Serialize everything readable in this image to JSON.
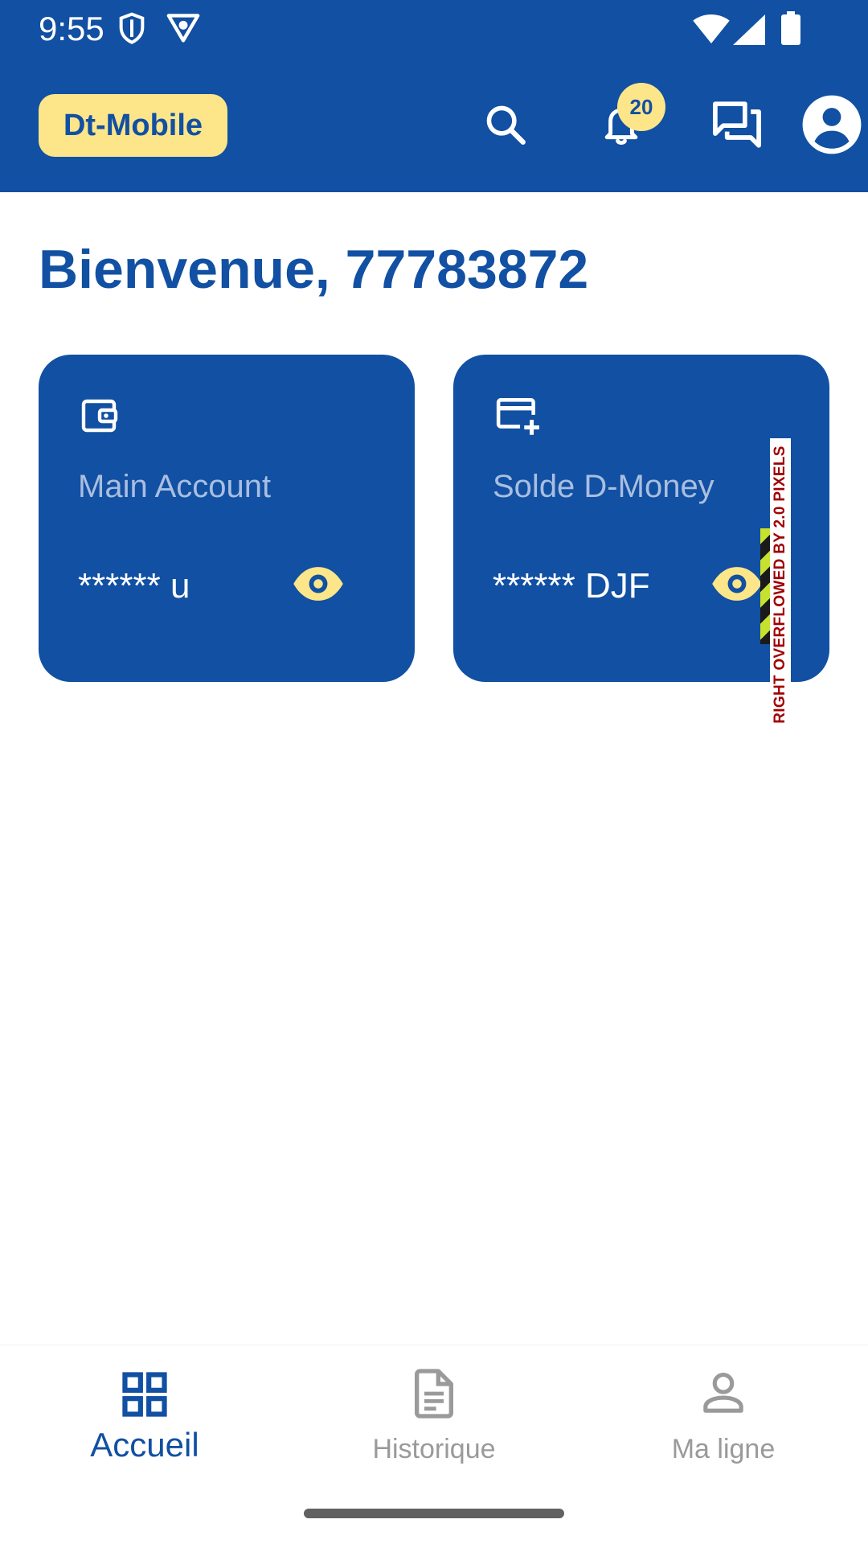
{
  "status_bar": {
    "time": "9:55",
    "left_icons": [
      "shield-icon",
      "vpn-icon"
    ],
    "right_icons": [
      "wifi-icon",
      "signal-icon",
      "battery-icon"
    ]
  },
  "app_bar": {
    "brand": "Dt-Mobile",
    "actions": [
      "search-icon",
      "notifications-icon",
      "chat-icon",
      "account-icon"
    ],
    "notification_count": "20"
  },
  "welcome": {
    "text": "Bienvenue, 77783872"
  },
  "cards": [
    {
      "icon": "wallet-icon",
      "label": "Main Account",
      "value": "****** u",
      "toggle_icon": "eye-icon"
    },
    {
      "icon": "card-add-icon",
      "label": "Solde D-Money",
      "value": "****** DJF",
      "toggle_icon": "eye-icon"
    }
  ],
  "overflow_indicator": {
    "text": "RIGHT OVERFLOWED BY 2.0 PIXELS"
  },
  "bottom_nav": {
    "items": [
      {
        "label": "Accueil",
        "icon": "grid-icon",
        "active": true
      },
      {
        "label": "Historique",
        "icon": "document-icon",
        "active": false
      },
      {
        "label": "Ma ligne",
        "icon": "person-icon",
        "active": false
      }
    ]
  },
  "colors": {
    "primary": "#1150A2",
    "accent": "#FDE58A",
    "card_label": "#A9BEE0",
    "inactive": "#9A9A9A"
  }
}
